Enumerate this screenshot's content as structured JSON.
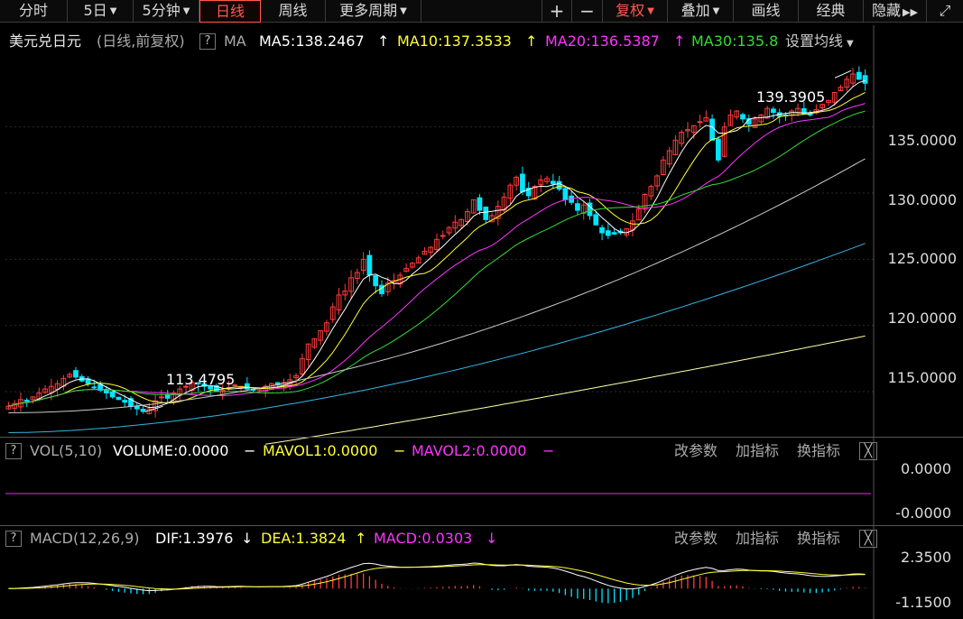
{
  "toolbar": {
    "tabs": [
      {
        "label": "分时",
        "active": false,
        "dropdown": false
      },
      {
        "label": "5日",
        "active": false,
        "dropdown": true
      },
      {
        "label": "5分钟",
        "active": false,
        "dropdown": true
      },
      {
        "label": "日线",
        "active": true,
        "dropdown": false
      },
      {
        "label": "周线",
        "active": false,
        "dropdown": false
      },
      {
        "label": "更多周期",
        "active": false,
        "dropdown": true
      }
    ],
    "zoom_in": "+",
    "zoom_out": "−",
    "fuquan": "复权",
    "overlay": "叠加",
    "draw": "画线",
    "classic": "经典",
    "hide": "隐藏"
  },
  "main_legend": {
    "symbol": "美元兑日元",
    "mode": "(日线,前复权)",
    "help": "?",
    "indicator": "MA",
    "ma5": "MA5:138.2467",
    "ma10": "MA10:137.3533",
    "ma20": "MA20:136.5387",
    "ma30": "MA30:135.8",
    "settings": "设置均线"
  },
  "annotations": {
    "high": "139.3905",
    "low": "113.4795"
  },
  "price_axis": [
    "135.0000",
    "130.0000",
    "125.0000",
    "120.0000",
    "115.0000"
  ],
  "vol_legend": {
    "help": "?",
    "name": "VOL(5,10)",
    "volume": "VOLUME:0.0000",
    "mavol1": "MAVOL1:0.0000",
    "mavol2": "MAVOL2:0.0000",
    "change_params": "改参数",
    "add_indicator": "加指标",
    "swap_indicator": "换指标",
    "close": "╳"
  },
  "vol_axis": [
    "0.0000",
    "-0.0000"
  ],
  "macd_legend": {
    "help": "?",
    "name": "MACD(12,26,9)",
    "dif": "DIF:1.3976",
    "dea": "DEA:1.3824",
    "macd": "MACD:0.0303",
    "change_params": "改参数",
    "add_indicator": "加指标",
    "swap_indicator": "换指标",
    "close": "╳"
  },
  "macd_axis": [
    "2.3500",
    "-1.1500"
  ],
  "colors": {
    "up": "#ff3b3b",
    "down": "#00e5ff",
    "ma5": "#ffffff",
    "ma10": "#ffff33",
    "ma20": "#ff33ff",
    "ma30": "#33dd33",
    "ma60": "#c8c8c8",
    "ma120": "#33b5e5",
    "ma250": "#ffffaa"
  },
  "chart_data": {
    "type": "candlestick",
    "price_ylim": [
      112.0,
      140.5
    ],
    "high": 139.3905,
    "low": 113.4795,
    "close_series": [
      113.9,
      114.1,
      114.4,
      114.3,
      114.6,
      114.9,
      115.2,
      115.4,
      115.6,
      116.0,
      116.3,
      116.1,
      115.8,
      115.6,
      115.3,
      115.1,
      114.9,
      114.6,
      114.4,
      114.2,
      113.9,
      113.7,
      113.5,
      113.7,
      114.3,
      114.6,
      114.5,
      114.9,
      115.2,
      115.4,
      115.7,
      115.6,
      115.4,
      115.2,
      115.0,
      115.1,
      115.3,
      115.5,
      115.4,
      115.2,
      115.1,
      115.2,
      115.4,
      115.6,
      115.5,
      115.7,
      115.9,
      116.2,
      117.5,
      118.6,
      119.0,
      119.6,
      120.2,
      121.4,
      122.3,
      122.6,
      123.6,
      124.0,
      125.0,
      123.8,
      123.0,
      122.4,
      123.2,
      123.4,
      123.8,
      124.3,
      124.7,
      125.1,
      125.6,
      125.9,
      126.5,
      126.8,
      127.4,
      127.8,
      128.0,
      128.6,
      129.5,
      128.7,
      128.0,
      128.3,
      129.0,
      129.7,
      130.6,
      131.2,
      130.1,
      129.8,
      130.5,
      131.0,
      131.1,
      130.7,
      130.3,
      129.5,
      129.3,
      128.7,
      129.1,
      128.3,
      127.6,
      127.0,
      126.8,
      126.9,
      127.0,
      127.3,
      127.9,
      128.8,
      129.9,
      130.5,
      131.3,
      132.5,
      133.2,
      134.0,
      134.6,
      134.8,
      135.1,
      135.4,
      135.7,
      134.0,
      132.5,
      135.0,
      135.9,
      136.2,
      135.6,
      135.2,
      135.6,
      135.9,
      136.4,
      136.1,
      135.8,
      135.9,
      136.2,
      136.4,
      136.0,
      135.9,
      136.3,
      136.7,
      137.0,
      137.6,
      138.0,
      138.6,
      139.0,
      138.6,
      138.3
    ],
    "ma_values": {
      "MA5": 138.2467,
      "MA10": 137.3533,
      "MA20": 136.5387,
      "MA30": 135.8
    },
    "volume": {
      "VOLUME": 0.0,
      "MAVOL1": 0.0,
      "MAVOL2": 0.0,
      "ylim": [
        -0.0,
        0.0
      ]
    },
    "macd": {
      "DIF": 1.3976,
      "DEA": 1.3824,
      "MACD": 0.0303,
      "ylim": [
        -1.15,
        2.35
      ]
    }
  }
}
